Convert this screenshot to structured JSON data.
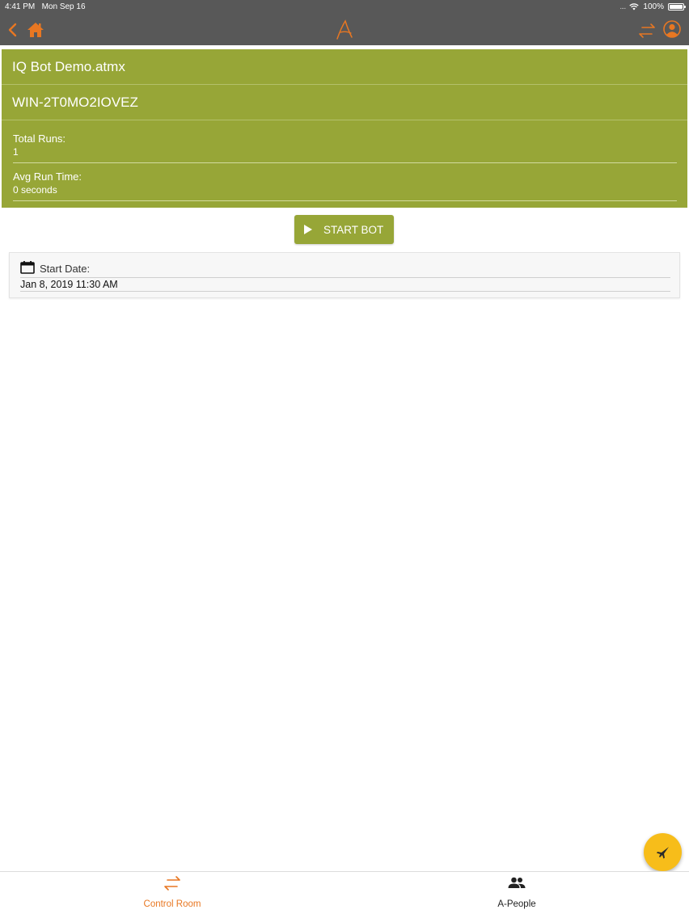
{
  "status_bar": {
    "time": "4:41 PM",
    "date": "Mon Sep 16",
    "signal": "....",
    "battery": "100%"
  },
  "colors": {
    "accent_orange": "#e87722",
    "panel_green": "#97a637",
    "fab_yellow": "#f7bd1a",
    "topbar_gray": "#585858"
  },
  "nav": {
    "back_icon": "chevron-left-icon",
    "home_icon": "home-icon",
    "logo_icon": "automation-anywhere-logo",
    "switch_icon": "swap-arrows-icon",
    "profile_icon": "user-circle-icon"
  },
  "bot": {
    "name": "IQ Bot Demo.atmx",
    "machine": "WIN-2T0MO2IOVEZ",
    "total_runs_label": "Total Runs:",
    "total_runs_value": "1",
    "avg_run_time_label": "Avg Run Time:",
    "avg_run_time_value": "0 seconds"
  },
  "start_button": {
    "label": "START BOT",
    "icon": "play-icon"
  },
  "schedule": {
    "icon": "calendar-icon",
    "start_date_label": "Start Date:",
    "start_date_value": "Jan 8, 2019 11:30 AM"
  },
  "fab": {
    "icon": "jet-icon"
  },
  "tabs": [
    {
      "label": "Control Room",
      "icon": "swap-arrows-icon",
      "active": true
    },
    {
      "label": "A-People",
      "icon": "people-icon",
      "active": false
    }
  ]
}
